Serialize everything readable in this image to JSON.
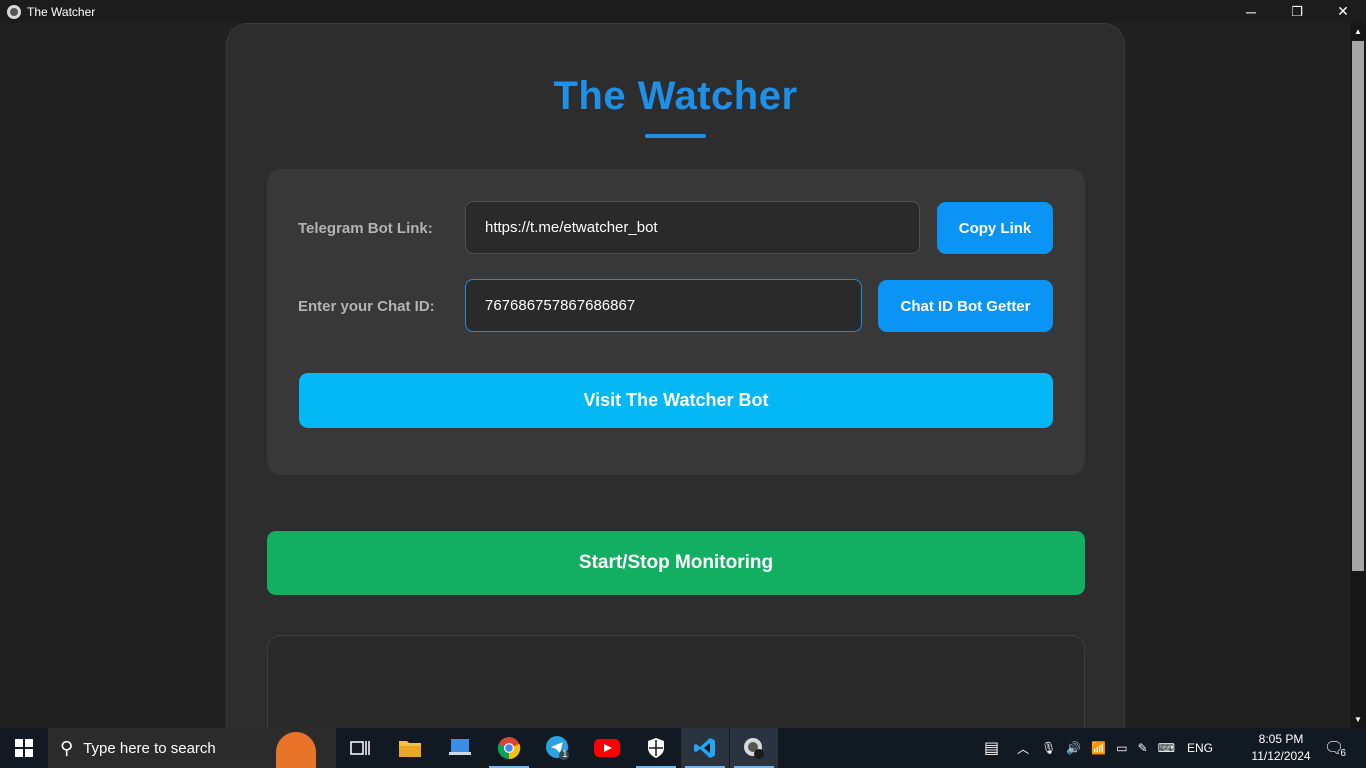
{
  "window": {
    "title": "The Watcher",
    "minimize_glyph": "─",
    "restore_glyph": "❐",
    "close_glyph": "✕"
  },
  "app": {
    "heading": "The Watcher",
    "bot_link_label": "Telegram Bot Link:",
    "bot_link_value": "https://t.me/etwatcher_bot",
    "copy_link_button": "Copy Link",
    "chat_id_label": "Enter your Chat ID:",
    "chat_id_value": "767686757867686867",
    "chat_id_bot_button": "Chat ID Bot Getter",
    "visit_bot_button": "Visit The Watcher Bot",
    "monitor_button": "Start/Stop Monitoring"
  },
  "taskbar": {
    "search_placeholder": "Type here to search",
    "apps": [
      "task-view-icon",
      "file-explorer-icon",
      "laptop-icon",
      "chrome-icon",
      "telegram-icon",
      "youtube-icon",
      "security-icon",
      "vscode-icon",
      "watcher-app-icon"
    ],
    "telegram_badge": "1",
    "language": "ENG",
    "time": "8:05 PM",
    "date": "11/12/2024",
    "notification_count": "6"
  },
  "colors": {
    "accent": "#1e90e8",
    "visit_button": "#03b8f4",
    "monitor_button": "#12ae62",
    "copy_button": "#0a94f5"
  }
}
